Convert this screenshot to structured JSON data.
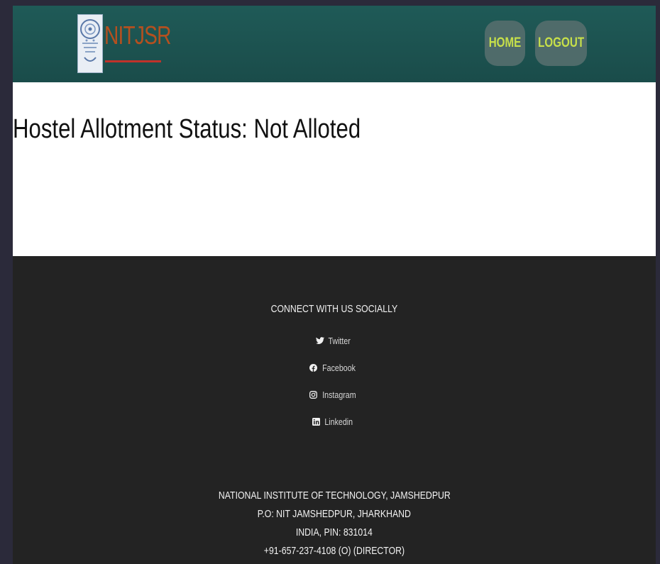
{
  "header": {
    "logo_text": "NITJSR",
    "nav": {
      "home_label": "HOME",
      "logout_label": "LOGOUT"
    }
  },
  "main": {
    "status_heading": "Hostel Allotment Status: Not Alloted"
  },
  "footer": {
    "connect_title": "CONNECT WITH US SOCIALLY",
    "social_links": [
      {
        "label": "Twitter",
        "icon": "twitter-icon"
      },
      {
        "label": "Facebook",
        "icon": "facebook-icon"
      },
      {
        "label": "Instagram",
        "icon": "instagram-icon"
      },
      {
        "label": "Linkedin",
        "icon": "linkedin-icon"
      }
    ],
    "address_lines": [
      "NATIONAL INSTITUTE OF TECHNOLOGY, JAMSHEDPUR",
      "P.O: NIT JAMSHEDPUR, JHARKHAND",
      "INDIA, PIN: 831014",
      "+91-657-237-4108 (O) (DIRECTOR)"
    ]
  },
  "colors": {
    "header_bg": "#1f5a57",
    "logo_text": "#b5501f",
    "nav_button_bg": "#4f6b6a",
    "nav_button_text": "#c7e04a",
    "footer_bg": "#232323"
  }
}
